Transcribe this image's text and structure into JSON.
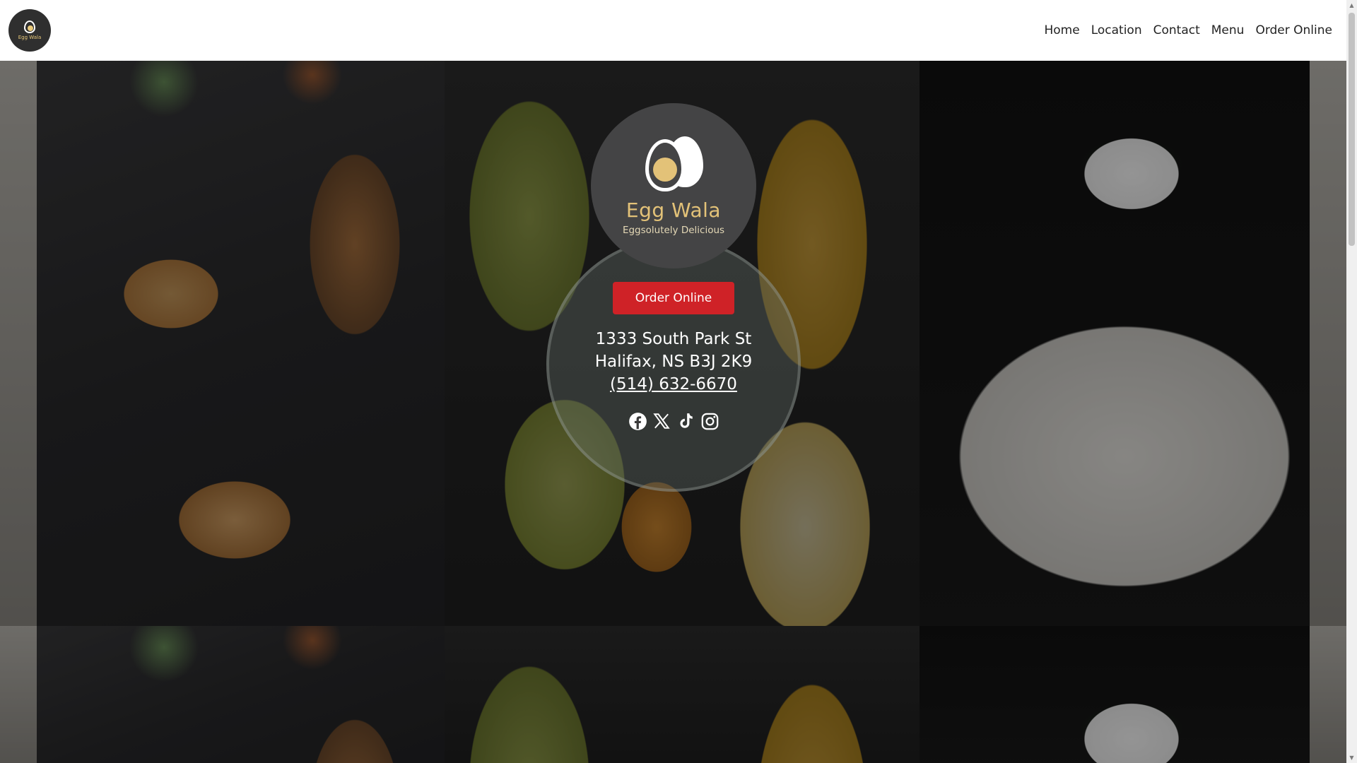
{
  "nav": {
    "logo_text": "Egg Wala",
    "links": [
      "Home",
      "Location",
      "Contact",
      "Menu",
      "Order Online"
    ]
  },
  "hero": {
    "brand_name": "Egg Wala",
    "tagline": "Eggsolutely Delicious",
    "order_button": "Order Online",
    "address_line1": "1333 South Park St",
    "address_line2": "Halifax, NS B3J 2K9",
    "phone": "(514) 632-6670",
    "social_icons": [
      "facebook-icon",
      "x-icon",
      "tiktok-icon",
      "instagram-icon"
    ]
  },
  "colors": {
    "order_button": "#cf2227",
    "brand_gold": "#e3c278",
    "logo_bg": "#444445"
  }
}
